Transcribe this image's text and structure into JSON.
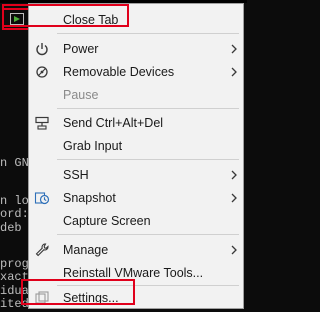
{
  "terminal": {
    "lines": [
      "n GN",
      "n lo",
      "ord:",
      " deb",
      "progr",
      "xact",
      "idua",
      "ited"
    ]
  },
  "menu": {
    "items": [
      {
        "label": "Close Tab"
      },
      {
        "label": "Power"
      },
      {
        "label": "Removable Devices"
      },
      {
        "label": "Pause",
        "disabled": true
      },
      {
        "label": "Send Ctrl+Alt+Del"
      },
      {
        "label": "Grab Input"
      },
      {
        "label": "SSH"
      },
      {
        "label": "Snapshot"
      },
      {
        "label": "Capture Screen"
      },
      {
        "label": "Manage"
      },
      {
        "label": "Reinstall VMware Tools..."
      },
      {
        "label": "Settings..."
      }
    ]
  },
  "colors": {
    "menu_bg": "#f2f2f2",
    "highlight": "#e0001b",
    "vm_icon_green": "#4caf3a",
    "terminal_bg": "#0c0c0c"
  },
  "icons": {
    "vm": "vm-console-icon",
    "power": "power-icon",
    "removable": "removable-devices-icon",
    "send_keys": "keyboard-send-icon",
    "snapshot": "snapshot-icon",
    "manage": "wrench-icon",
    "settings": "settings-icon"
  }
}
